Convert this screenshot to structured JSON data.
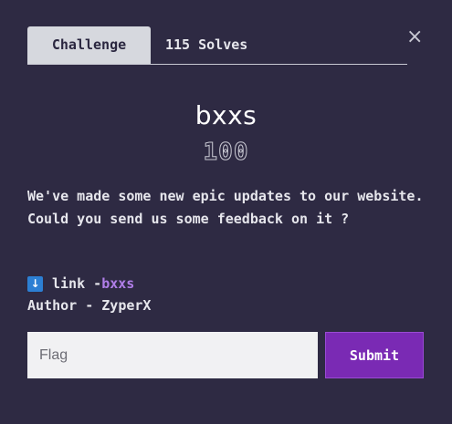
{
  "modal": {
    "close_label": "×",
    "tabs": [
      {
        "label": "Challenge",
        "active": true
      },
      {
        "label": "115 Solves",
        "active": false
      }
    ],
    "challenge": {
      "name": "bxxs",
      "value": "100",
      "description": "We've made some new epic updates to our website. Could you send us some feedback on it ?",
      "link_icon": "down-arrow-icon",
      "link_label": "link - ",
      "link_text": "bxxs",
      "author_line": "Author - ZyperX"
    },
    "form": {
      "flag_placeholder": "Flag",
      "flag_value": "",
      "submit_label": "Submit"
    }
  },
  "colors": {
    "background": "#2e2a43",
    "accent": "#7a2ab4",
    "link": "#b07ee8"
  }
}
